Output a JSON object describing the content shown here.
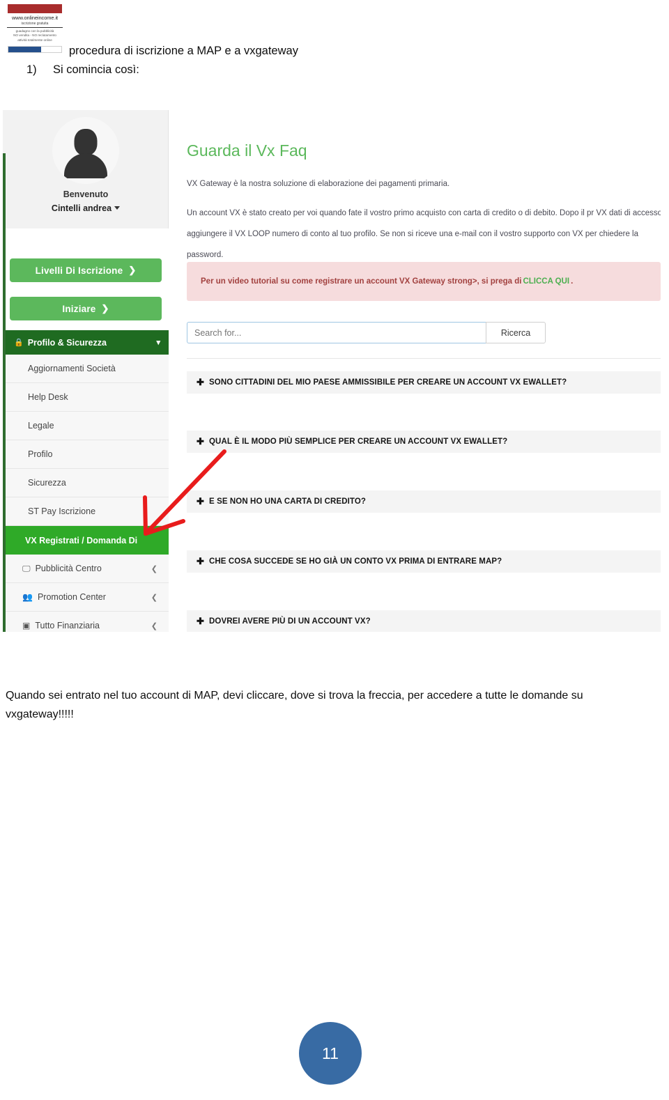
{
  "document": {
    "title": "procedura di iscrizione a MAP e a vxgateway",
    "step_number": "1)",
    "step_text": "Si comincia così:",
    "caption": "Quando sei entrato nel tuo account di MAP, devi cliccare, dove si trova la freccia, per accedere a tutte le domande su vxgateway!!!!!",
    "page_number": "11"
  },
  "logo": {
    "url": "www.onlineincome.it",
    "subtitle": "iscrizione gratuita",
    "line1": "guadagno con la pubblicità",
    "line2": "NO vendita - NO reclutamento",
    "line3": "attività totalmente online",
    "bar_red": "#a82c2c",
    "bar_blue": "#25508c"
  },
  "screenshot": {
    "sidebar": {
      "welcome_label": "Benvenuto",
      "username": "Cintelli andrea",
      "avatar_icon": "user-avatar-icon",
      "caret_icon": "caret-down-icon",
      "buttons": [
        {
          "label": "Livelli Di Iscrizione",
          "arrow": "❯",
          "color": "#5cb85c"
        },
        {
          "label": "Iniziare",
          "arrow": "❯",
          "color": "#5cb85c"
        }
      ],
      "section_header": {
        "label": "Profilo & Sicurezza",
        "lock_icon": "lock-icon",
        "chevron_icon": "chevron-down-icon",
        "color": "#1f6b21"
      },
      "items": [
        {
          "label": "Aggiornamenti Società",
          "icon": "",
          "chevron": "",
          "active": false
        },
        {
          "label": "Help Desk",
          "icon": "",
          "chevron": "",
          "active": false
        },
        {
          "label": "Legale",
          "icon": "",
          "chevron": "",
          "active": false
        },
        {
          "label": "Profilo",
          "icon": "",
          "chevron": "",
          "active": false
        },
        {
          "label": "Sicurezza",
          "icon": "",
          "chevron": "",
          "active": false
        },
        {
          "label": "ST Pay Iscrizione",
          "icon": "",
          "chevron": "",
          "active": false
        },
        {
          "label": "VX Registrati / Domanda Di",
          "icon": "",
          "chevron": "",
          "active": true
        },
        {
          "label": "Pubblicità Centro",
          "icon": "🖵",
          "chevron": "❮",
          "active": false
        },
        {
          "label": "Promotion Center",
          "icon": "👥",
          "chevron": "❮",
          "active": false
        },
        {
          "label": "Tutto Finanziaria",
          "icon": "▣",
          "chevron": "❮",
          "active": false
        }
      ],
      "active_color": "#2faa28"
    },
    "main": {
      "heading": "Guarda il Vx Faq",
      "heading_color": "#5bb85b",
      "paragraph1": "VX Gateway è la nostra soluzione di elaborazione dei pagamenti primaria.",
      "paragraph2": "Un account VX è stato creato per voi quando fate il vostro primo acquisto con carta di credito o di debito. Dopo il pr VX dati di accesso e aggiungere il VX LOOP numero di conto al tuo profilo. Se non si riceve una e-mail con il vostro supporto con VX per chiedere la password.",
      "alert": {
        "text_before": "Per un video tutorial su come registrare un account VX Gateway strong>, si prega di",
        "link_text": "CLICCA QUI",
        "text_after": ".",
        "bg_color": "#f6dcdd",
        "text_color": "#a2413f",
        "link_color": "#4caf50"
      },
      "search": {
        "placeholder": "Search for...",
        "value": "",
        "button_label": "Ricerca"
      },
      "faq_items": [
        {
          "plus_icon": "plus-icon",
          "label": "SONO CITTADINI DEL MIO PAESE AMMISSIBILE PER CREARE UN ACCOUNT VX EWALLET?"
        },
        {
          "plus_icon": "plus-icon",
          "label": "QUAL È IL MODO PIÙ SEMPLICE PER CREARE UN ACCOUNT VX EWALLET?"
        },
        {
          "plus_icon": "plus-icon",
          "label": "E SE NON HO UNA CARTA DI CREDITO?"
        },
        {
          "plus_icon": "plus-icon",
          "label": "CHE COSA SUCCEDE SE HO GIÀ UN CONTO VX PRIMA DI ENTRARE MAP?"
        },
        {
          "plus_icon": "plus-icon",
          "label": "DOVREI AVERE PIÙ DI UN ACCOUNT VX?"
        }
      ]
    },
    "annotation": {
      "arrow_icon": "red-arrow-icon",
      "color": "#e81c1c"
    }
  }
}
